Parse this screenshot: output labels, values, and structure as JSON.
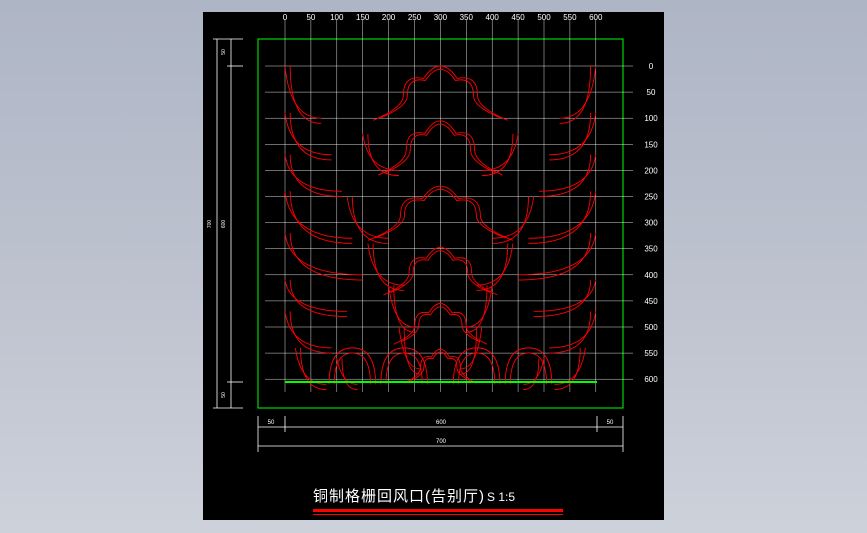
{
  "drawing": {
    "title": "铜制格栅回风口(告别厅)",
    "scale": "S 1:5",
    "x_ticks": [
      "0",
      "50",
      "100",
      "150",
      "200",
      "250",
      "300",
      "350",
      "400",
      "450",
      "500",
      "550",
      "600"
    ],
    "y_ticks": [
      "0",
      "50",
      "100",
      "150",
      "200",
      "250",
      "300",
      "350",
      "400",
      "450",
      "500",
      "550",
      "600"
    ],
    "dims_bottom": {
      "left": "50",
      "middle": "600",
      "right": "50",
      "total": "700"
    },
    "dims_left": {
      "top": "50",
      "middle": "600",
      "bottom": "50",
      "total": "700"
    },
    "colors": {
      "background": "#000000",
      "grid": "#ffffff",
      "frame": "#00ff00",
      "pattern": "#ff0000",
      "dims": "#ffffff"
    }
  }
}
